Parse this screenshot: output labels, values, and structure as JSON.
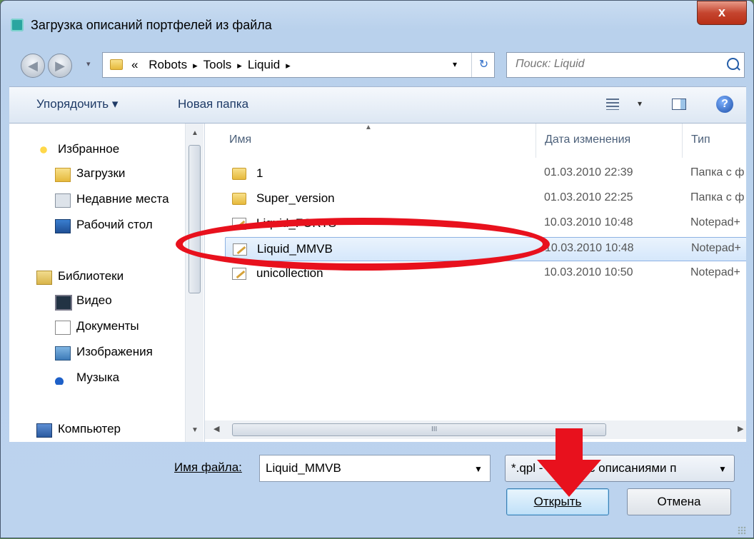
{
  "window": {
    "title": "Загрузка описаний портфелей из файла",
    "close_label": "x"
  },
  "address": {
    "prefix": "«",
    "crumbs": [
      "Robots",
      "Tools",
      "Liquid"
    ],
    "separator": "▸"
  },
  "search": {
    "placeholder": "Поиск: Liquid"
  },
  "toolbar": {
    "organize_label": "Упорядочить ▾",
    "newfolder_label": "Новая папка",
    "views_drop": "▾",
    "help": "?"
  },
  "sidebar": {
    "favorites_label": "Избранное",
    "favorites": [
      "Загрузки",
      "Недавние места",
      "Рабочий стол"
    ],
    "libraries_label": "Библиотеки",
    "libraries": [
      "Видео",
      "Документы",
      "Изображения",
      "Музыка"
    ],
    "computer_label": "Компьютер"
  },
  "filelist": {
    "columns": {
      "name": "Имя",
      "date": "Дата изменения",
      "type": "Тип"
    },
    "rows": [
      {
        "name": "1",
        "date": "01.03.2010 22:39",
        "type": "Папка с ф",
        "kind": "folder"
      },
      {
        "name": "Super_version",
        "date": "01.03.2010 22:25",
        "type": "Папка с ф",
        "kind": "folder"
      },
      {
        "name": "Liquid_FORTS",
        "date": "10.03.2010 10:48",
        "type": "Notepad+",
        "kind": "notepad"
      },
      {
        "name": "Liquid_MMVB",
        "date": "10.03.2010 10:48",
        "type": "Notepad+",
        "kind": "notepad"
      },
      {
        "name": "unicollection",
        "date": "10.03.2010 10:50",
        "type": "Notepad+",
        "kind": "notepad"
      }
    ],
    "selected_index": 3
  },
  "hscroll": {
    "grip": "III"
  },
  "bottom": {
    "filename_label": "Имя файла:",
    "filename_value": "Liquid_MMVB",
    "filter_value": "*.qpl - файлы с описаниями п",
    "open_label": "Открыть",
    "cancel_label": "Отмена"
  },
  "colors": {
    "annotation": "#e8111d",
    "selection": "#d5e7fb",
    "accent": "#3c7fb1"
  },
  "icons": {
    "app": "app-icon",
    "back": "back-arrow-icon",
    "forward": "forward-arrow-icon",
    "refresh": "refresh-icon",
    "search": "search-icon",
    "views": "views-icon",
    "preview": "preview-pane-icon",
    "help": "help-icon"
  }
}
